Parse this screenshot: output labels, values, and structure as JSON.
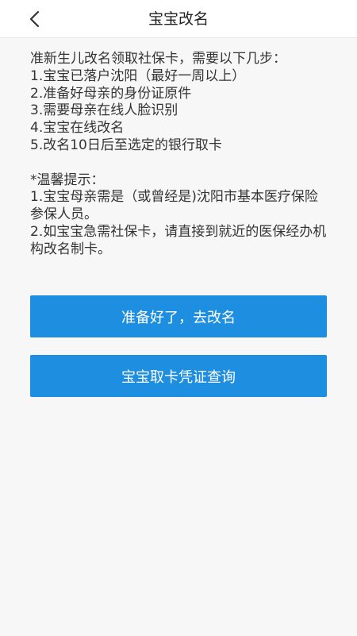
{
  "header": {
    "title": "宝宝改名",
    "back_icon": "chevron-left-icon"
  },
  "intro": {
    "heading": "准新生儿改名领取社保卡，需要以下几步：",
    "steps": [
      "1.宝宝已落户沈阳（最好一周以上）",
      "2.准备好母亲的身份证原件",
      "3.需要母亲在线人脸识别",
      "4.宝宝在线改名",
      "5.改名10日后至选定的银行取卡"
    ]
  },
  "tips": {
    "title": "*温馨提示：",
    "items": [
      "1.宝宝母亲需是（或曾经是)沈阳市基本医疗保险参保人员。",
      "2.如宝宝急需社保卡，请直接到就近的医保经办机构改名制卡。"
    ]
  },
  "buttons": {
    "rename": "准备好了，去改名",
    "card_query": "宝宝取卡凭证查询"
  },
  "colors": {
    "primary": "#1e8ee0",
    "background": "#f7f7f7",
    "header_bg": "#ffffff",
    "text": "#333333"
  }
}
